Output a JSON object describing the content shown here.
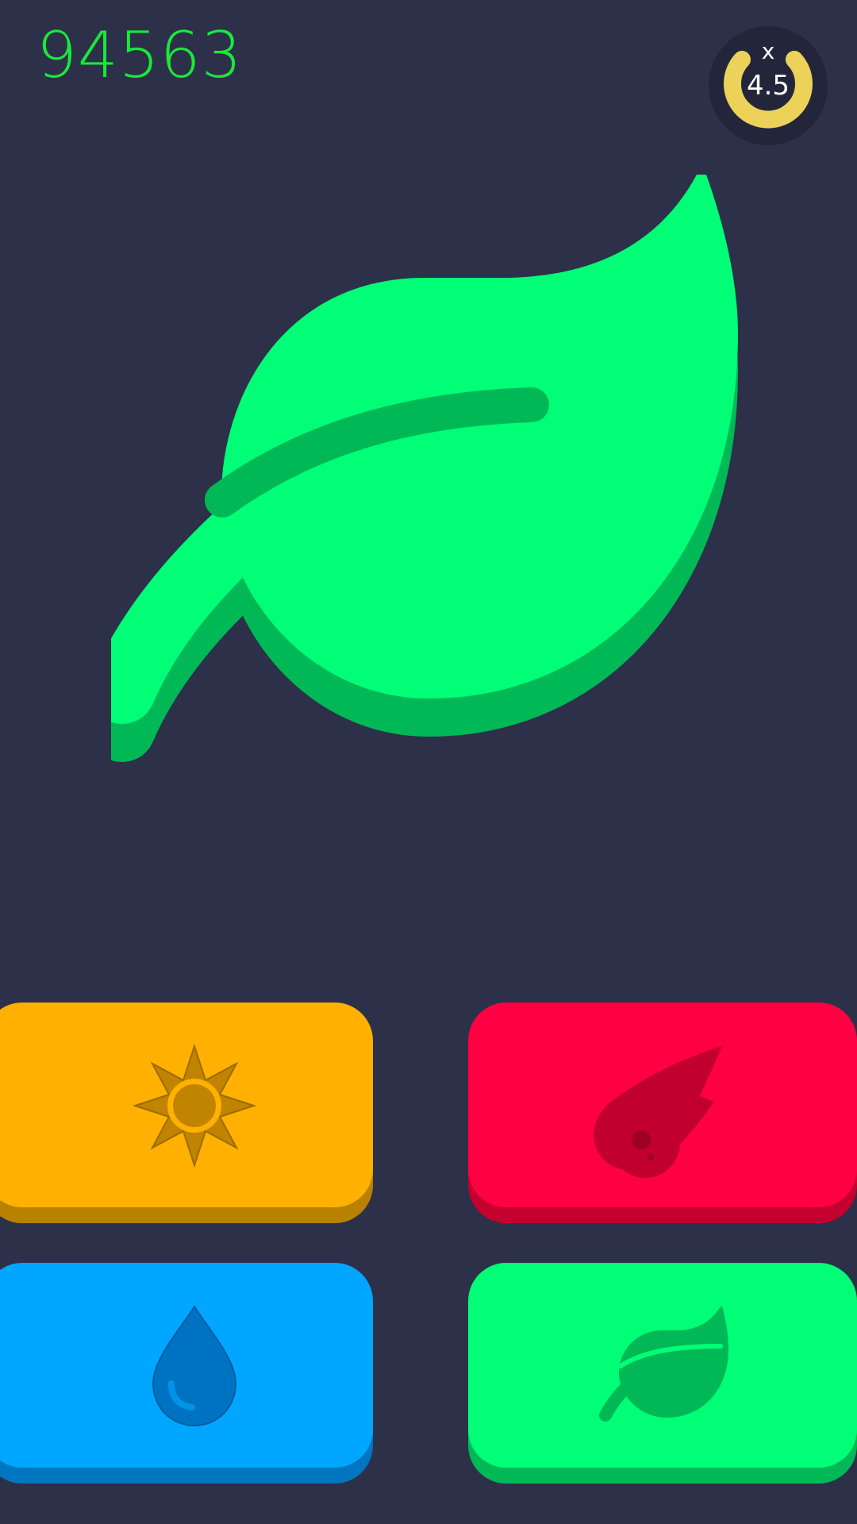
{
  "score": "94563",
  "multiplier": {
    "prefix": "x",
    "value": "4.5",
    "ring_color": "#edd25a"
  },
  "target": {
    "element": "leaf",
    "icon": "leaf-icon",
    "color": "#00ff77"
  },
  "buttons": [
    {
      "element": "sun",
      "icon": "sun-icon",
      "color": "#ffb000"
    },
    {
      "element": "fire",
      "icon": "fire-icon",
      "color": "#ff0042"
    },
    {
      "element": "water",
      "icon": "water-drop-icon",
      "color": "#00a6ff"
    },
    {
      "element": "leaf",
      "icon": "leaf-icon",
      "color": "#00ff77"
    }
  ],
  "colors": {
    "background": "#2d3049",
    "score_text": "#19e93a"
  }
}
